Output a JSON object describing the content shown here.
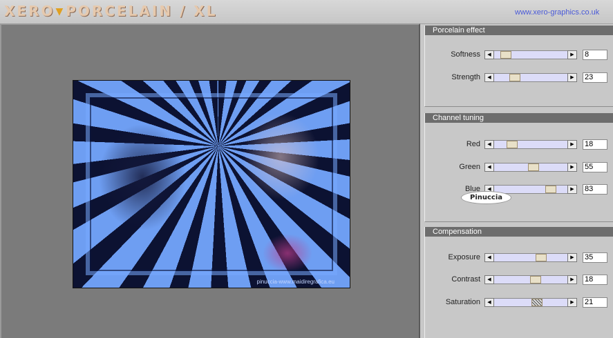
{
  "header": {
    "logo_text_1": "XERO",
    "logo_text_2": "PORCELAIN / XL",
    "logo_separator": "▼",
    "website": "www.xero-graphics.co.uk"
  },
  "preview": {
    "credit": "pinuccia-www.maidiregrafica.eu"
  },
  "watermark": "Pinuccia",
  "panels": [
    {
      "title": "Porcelain effect",
      "controls": [
        {
          "label": "Softness",
          "value": "8"
        },
        {
          "label": "Strength",
          "value": "23"
        }
      ]
    },
    {
      "title": "Channel tuning",
      "controls": [
        {
          "label": "Red",
          "value": "18"
        },
        {
          "label": "Green",
          "value": "55"
        },
        {
          "label": "Blue",
          "value": "83"
        }
      ]
    },
    {
      "title": "Compensation",
      "controls": [
        {
          "label": "Exposure",
          "value": "35"
        },
        {
          "label": "Contrast",
          "value": "18"
        },
        {
          "label": "Saturation",
          "value": "21"
        }
      ]
    }
  ]
}
